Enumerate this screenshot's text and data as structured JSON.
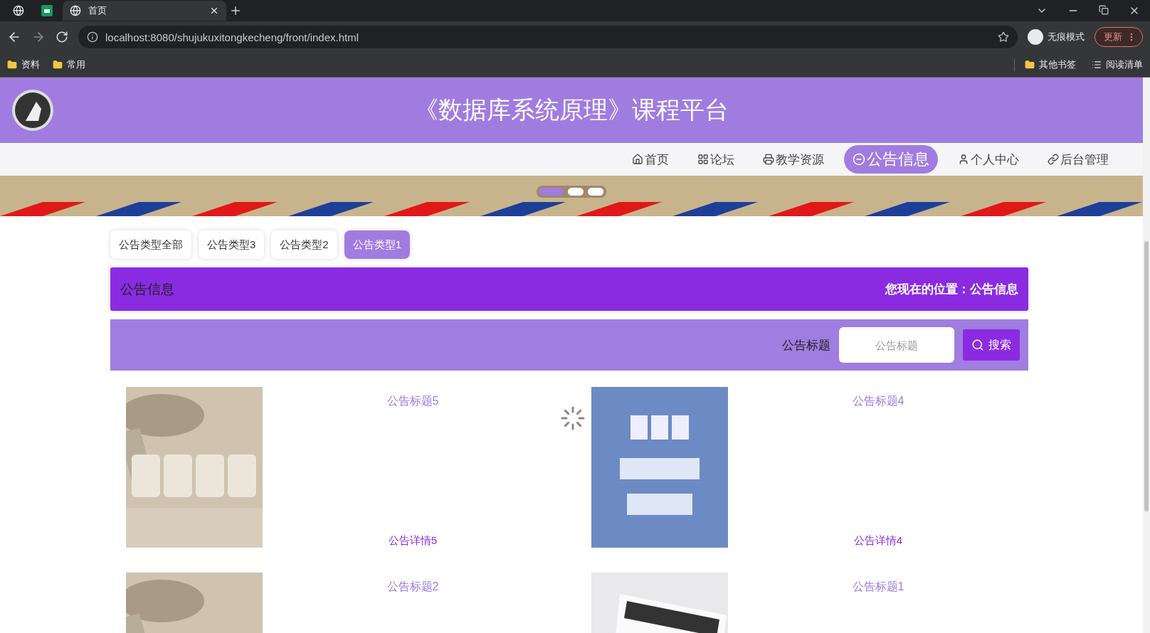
{
  "browser": {
    "tabs": [
      {
        "kind": "icon",
        "selected": false
      },
      {
        "kind": "sheet",
        "selected": false
      },
      {
        "kind": "page",
        "title": "首页",
        "selected": true
      }
    ],
    "url": "localhost:8080/shujukuxitongkecheng/front/index.html",
    "incognito": "无痕模式",
    "update": "更新",
    "bookmarks": [
      "资料",
      "常用"
    ],
    "bookmarks_right": [
      {
        "kind": "folder",
        "label": "其他书签"
      },
      {
        "kind": "list",
        "label": "阅读清单"
      }
    ]
  },
  "header": {
    "title": "《数据库系统原理》课程平台"
  },
  "nav": [
    {
      "kind": "home",
      "label": "首页",
      "selected": false
    },
    {
      "kind": "forum",
      "label": "论坛",
      "selected": false
    },
    {
      "kind": "resource",
      "label": "教学资源",
      "selected": false
    },
    {
      "kind": "notice",
      "label": "公告信息",
      "selected": true
    },
    {
      "kind": "user",
      "label": "个人中心",
      "selected": false
    },
    {
      "kind": "admin",
      "label": "后台管理",
      "selected": false
    }
  ],
  "banner": {
    "dots": [
      {
        "selected": true
      },
      {
        "selected": false
      },
      {
        "selected": false
      }
    ]
  },
  "filters": [
    {
      "label": "公告类型全部",
      "selected": false
    },
    {
      "label": "公告类型3",
      "selected": false
    },
    {
      "label": "公告类型2",
      "selected": false
    },
    {
      "label": "公告类型1",
      "selected": true
    }
  ],
  "section": {
    "title": "公告信息",
    "breadcrumb": "您现在的位置：公告信息"
  },
  "search": {
    "label": "公告标题",
    "placeholder": "公告标题",
    "button": "搜索"
  },
  "cards": [
    {
      "title": "公告标题5",
      "detail": "公告详情5"
    },
    {
      "title": "公告标题4",
      "detail": "公告详情4",
      "loading": true
    },
    {
      "title": "公告标题2"
    },
    {
      "title": "公告标题1"
    }
  ]
}
